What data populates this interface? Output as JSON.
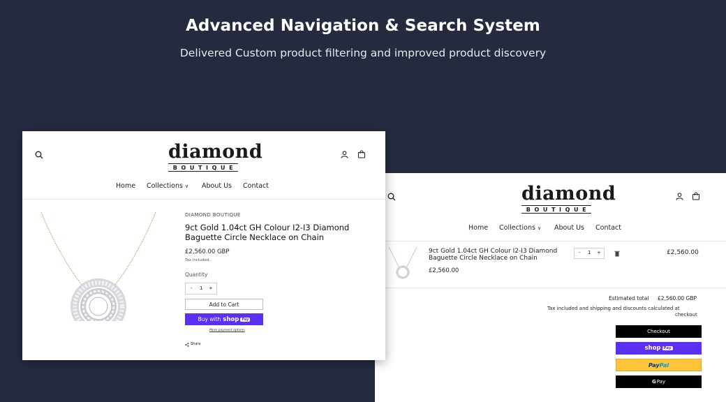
{
  "hero": {
    "title": "Advanced Navigation & Search System",
    "subtitle": "Delivered Custom product filtering and improved product discovery"
  },
  "brand": {
    "wordmark": "diamond",
    "tagline": "BOUTIQUE"
  },
  "nav": {
    "home": "Home",
    "collections": "Collections",
    "collections_chevron": "∨",
    "about": "About Us",
    "contact": "Contact"
  },
  "product": {
    "vendor": "DIAMOND BOUTIQUE",
    "title_line1": "9ct Gold 1.04ct GH Colour I2-I3 Diamond",
    "title_line2": "Baguette Circle Necklace on Chain",
    "price": "£2,560.00 GBP",
    "tax_note": "Tax included.",
    "quantity_label": "Quantity",
    "quantity_value": "1",
    "minus": "-",
    "plus": "+",
    "add_to_cart": "Add to Cart",
    "buy_with": "Buy with",
    "shop": "shop",
    "pay": "Pay",
    "more_payment": "More payment options",
    "share": "Share"
  },
  "cart": {
    "item_title_line1": "9ct Gold 1.04ct GH Colour I2-I3 Diamond",
    "item_title_line2": "Baguette Circle Necklace on Chain",
    "item_price": "£2,560.00",
    "quantity_value": "1",
    "minus": "-",
    "plus": "+",
    "line_total": "£2,560.00",
    "estimated_total_label": "Estimated total",
    "estimated_total_value": "£2,560.00 GBP",
    "tax_line1": "Tax included and shipping and discounts calculated at",
    "tax_line2": "checkout",
    "checkout": "Checkout",
    "shop": "shop",
    "pay": "Pay",
    "paypal_pay": "Pay",
    "paypal_pal": "Pal",
    "gpay_g": "G",
    "gpay_pay": "Pay"
  },
  "colors": {
    "background": "#252a3f",
    "shop_pay": "#5a31f4",
    "paypal": "#ffc439",
    "black_button": "#000000"
  },
  "icons": [
    "search-icon",
    "account-icon",
    "cart-icon",
    "trash-icon",
    "share-icon",
    "chevron-down-icon"
  ]
}
